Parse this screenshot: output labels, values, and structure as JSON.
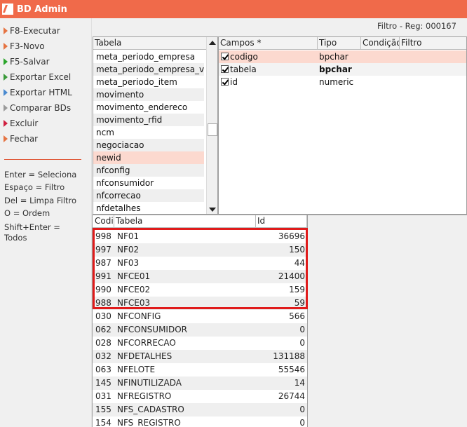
{
  "app": {
    "title": "BD Admin"
  },
  "menu": [
    {
      "label": "F8-Executar",
      "color": "#e57342"
    },
    {
      "label": "F3-Novo",
      "color": "#e57342"
    },
    {
      "label": "F5-Salvar",
      "color": "#2aa52a"
    },
    {
      "label": "Exportar Excel",
      "color": "#3a9a3a"
    },
    {
      "label": "Exportar HTML",
      "color": "#4a8ad0"
    },
    {
      "label": "Comparar BDs",
      "color": "#9a9a9a"
    },
    {
      "label": "Excluir",
      "color": "#d02040"
    },
    {
      "label": "Fechar",
      "color": "#e57342"
    }
  ],
  "help": [
    "Enter = Seleciona",
    "Espaço = Filtro",
    "Del = Limpa Filtro",
    "O  =  Ordem",
    "Shift+Enter =",
    "Todos"
  ],
  "status": "Filtro - Reg: 000167",
  "tables": {
    "header": "Tabela",
    "items": [
      "meta_periodo_empresa",
      "meta_periodo_empresa_vendedor",
      "meta_periodo_item",
      "movimento",
      "movimento_endereco",
      "movimento_rfid",
      "ncm",
      "negociacao",
      "newid",
      "nfconfig",
      "nfconsumidor",
      "nfcorrecao",
      "nfdetalhes"
    ],
    "selected_index": 8
  },
  "fields": {
    "headers": [
      "Campos *",
      "Tipo",
      "Condição",
      "Filtro"
    ],
    "rows": [
      {
        "name": "codigo",
        "type": "bpchar",
        "checked": true,
        "bold": false
      },
      {
        "name": "tabela",
        "type": "bpchar",
        "checked": true,
        "bold": true
      },
      {
        "name": "id",
        "type": "numeric",
        "checked": true,
        "bold": false
      }
    ]
  },
  "grid": {
    "headers": [
      "Codigo",
      "Tabela",
      "Id"
    ],
    "rows": [
      {
        "codigo": "998",
        "tabela": "NF01",
        "id": "36696"
      },
      {
        "codigo": "997",
        "tabela": "NF02",
        "id": "150"
      },
      {
        "codigo": "987",
        "tabela": "NF03",
        "id": "44"
      },
      {
        "codigo": "991",
        "tabela": "NFCE01",
        "id": "21400"
      },
      {
        "codigo": "990",
        "tabela": "NFCE02",
        "id": "159"
      },
      {
        "codigo": "988",
        "tabela": "NFCE03",
        "id": "59"
      },
      {
        "codigo": "030",
        "tabela": "NFCONFIG",
        "id": "566"
      },
      {
        "codigo": "062",
        "tabela": "NFCONSUMIDOR",
        "id": "0"
      },
      {
        "codigo": "028",
        "tabela": "NFCORRECAO",
        "id": "0"
      },
      {
        "codigo": "032",
        "tabela": "NFDETALHES",
        "id": "131188"
      },
      {
        "codigo": "063",
        "tabela": "NFELOTE",
        "id": "55546"
      },
      {
        "codigo": "145",
        "tabela": "NFINUTILIZADA",
        "id": "14"
      },
      {
        "codigo": "031",
        "tabela": "NFREGISTRO",
        "id": "26744"
      },
      {
        "codigo": "155",
        "tabela": "NFS_CADASTRO",
        "id": "0"
      },
      {
        "codigo": "154",
        "tabela": "NFS_REGISTRO",
        "id": "0"
      }
    ]
  }
}
